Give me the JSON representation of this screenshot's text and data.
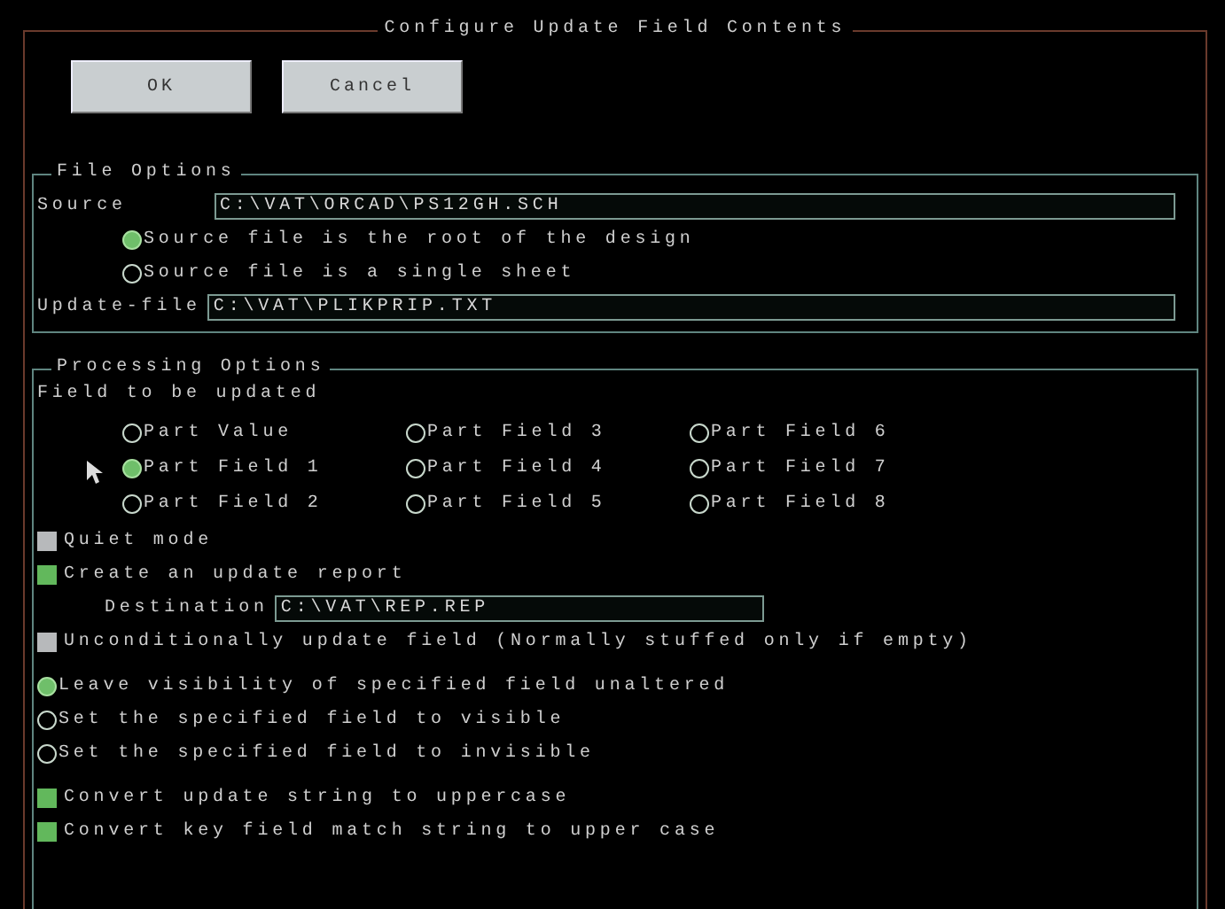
{
  "dialog": {
    "title": "Configure Update Field Contents"
  },
  "buttons": [
    {
      "label": "OK"
    },
    {
      "label": "Cancel"
    }
  ],
  "file_options": {
    "title": "File Options",
    "source": {
      "label": "Source",
      "value": "C:\\VAT\\ORCAD\\PS12GH.SCH"
    },
    "source_mode": [
      {
        "label": "Source file is the root of the design",
        "selected": true
      },
      {
        "label": "Source file is a single sheet",
        "selected": false
      }
    ],
    "update_file": {
      "label": "Update-file",
      "value": "C:\\VAT\\PLIKPRIP.TXT"
    }
  },
  "processing_options": {
    "title": "Processing Options",
    "field_label": "Field to be updated",
    "fields": [
      {
        "label": "Part Value",
        "selected": false
      },
      {
        "label": "Part Field 1",
        "selected": true
      },
      {
        "label": "Part Field 2",
        "selected": false
      },
      {
        "label": "Part Field 3",
        "selected": false
      },
      {
        "label": "Part Field 4",
        "selected": false
      },
      {
        "label": "Part Field 5",
        "selected": false
      },
      {
        "label": "Part Field 6",
        "selected": false
      },
      {
        "label": "Part Field 7",
        "selected": false
      },
      {
        "label": "Part Field 8",
        "selected": false
      }
    ],
    "options": [
      {
        "kind": "checkbox",
        "label": "Quiet mode",
        "checked": false
      },
      {
        "kind": "checkbox",
        "label": "Create an update report",
        "checked": true
      },
      {
        "kind": "field",
        "label": "Destination",
        "value": "C:\\VAT\\REP.REP"
      },
      {
        "kind": "checkbox",
        "label": "Unconditionally update field (Normally stuffed only if empty)",
        "checked": false
      },
      {
        "kind": "radio",
        "label": "Leave visibility of specified field unaltered",
        "selected": true
      },
      {
        "kind": "radio",
        "label": "Set the specified field to visible",
        "selected": false
      },
      {
        "kind": "radio",
        "label": "Set the specified field to invisible",
        "selected": false
      },
      {
        "kind": "checkbox",
        "label": "Convert update string to uppercase",
        "checked": true
      },
      {
        "kind": "checkbox",
        "label": "Convert key field match string to upper case",
        "checked": true
      }
    ]
  }
}
